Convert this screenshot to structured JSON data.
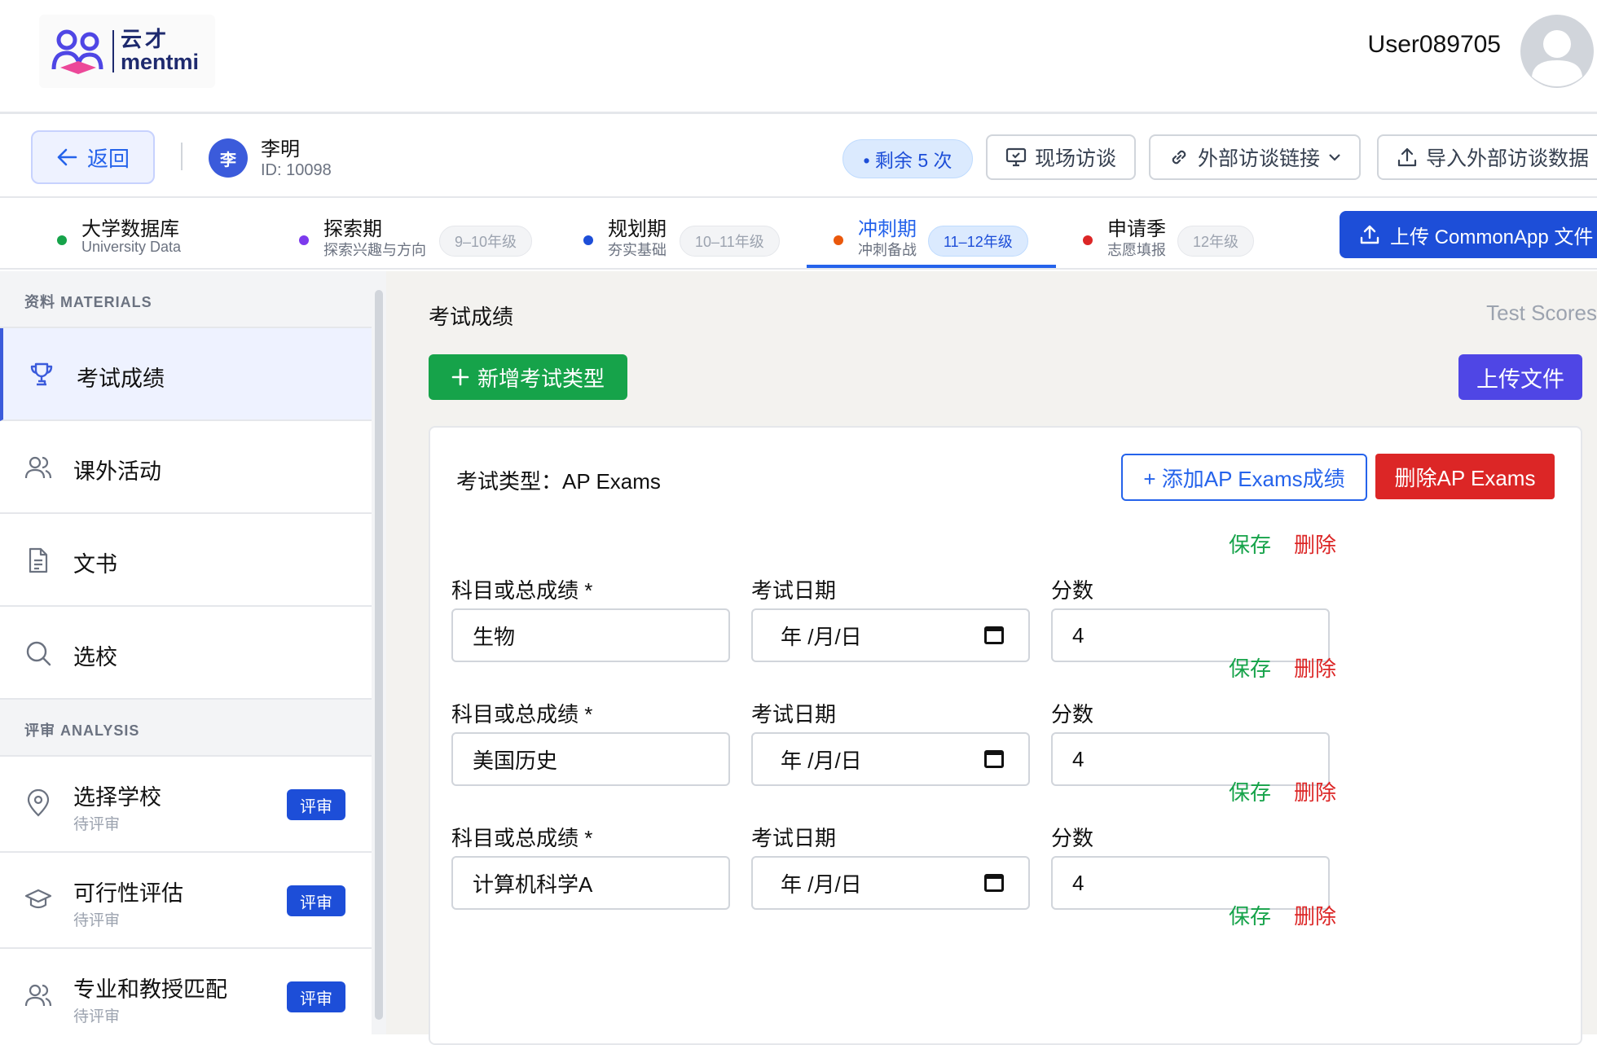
{
  "header": {
    "logo_cn": "云才",
    "logo_en": "mentmi",
    "user_name": "User089705"
  },
  "student": {
    "back_label": "返回",
    "avatar_char": "李",
    "name": "李明",
    "id": "ID: 10098",
    "remaining": "• 剩余 5 次",
    "btn_onsite": "现场访谈",
    "btn_external_link": "外部访谈链接",
    "btn_import": "导入外部访谈数据"
  },
  "stages": [
    {
      "title": "大学数据库",
      "sub": "University Data",
      "pill": "",
      "color": "#16a34a"
    },
    {
      "title": "探索期",
      "sub": "探索兴趣与方向",
      "pill": "9–10年级",
      "color": "#7c3aed"
    },
    {
      "title": "规划期",
      "sub": "夯实基础",
      "pill": "10–11年级",
      "color": "#1d4ed8"
    },
    {
      "title": "冲刺期",
      "sub": "冲刺备战",
      "pill": "11–12年级",
      "color": "#ea580c"
    },
    {
      "title": "申请季",
      "sub": "志愿填报",
      "pill": "12年级",
      "color": "#dc2626"
    }
  ],
  "upload_commonapp": "上传 CommonApp 文件",
  "sidebar": {
    "materials_head": "资料 MATERIALS",
    "materials": [
      {
        "label": "考试成绩",
        "icon": "trophy-icon"
      },
      {
        "label": "课外活动",
        "icon": "users-icon"
      },
      {
        "label": "文书",
        "icon": "document-icon"
      },
      {
        "label": "选校",
        "icon": "search-icon"
      }
    ],
    "analysis_head": "评审 ANALYSIS",
    "analysis": [
      {
        "label": "选择学校",
        "sub": "待评审",
        "badge": "评审",
        "icon": "location-pin-icon"
      },
      {
        "label": "可行性评估",
        "sub": "待评审",
        "badge": "评审",
        "icon": "graduation-cap-icon"
      },
      {
        "label": "专业和教授匹配",
        "sub": "待评审",
        "badge": "评审",
        "icon": "users-icon"
      }
    ]
  },
  "main": {
    "title": "考试成绩",
    "title_en": "Test Scores",
    "add_type": "新增考试类型",
    "upload_file": "上传文件",
    "exam_type": "考试类型：AP Exams",
    "add_score": "+ 添加AP Exams成绩",
    "del_exam": "删除AP Exams",
    "save": "保存",
    "delete": "删除",
    "field_subject": "科目或总成绩 *",
    "field_date": "考试日期",
    "field_score": "分数",
    "date_placeholder": "年 /月/日",
    "rows": [
      {
        "subject": "生物",
        "score": "4"
      },
      {
        "subject": "美国历史",
        "score": "4"
      },
      {
        "subject": "计算机科学A",
        "score": "4"
      }
    ]
  }
}
